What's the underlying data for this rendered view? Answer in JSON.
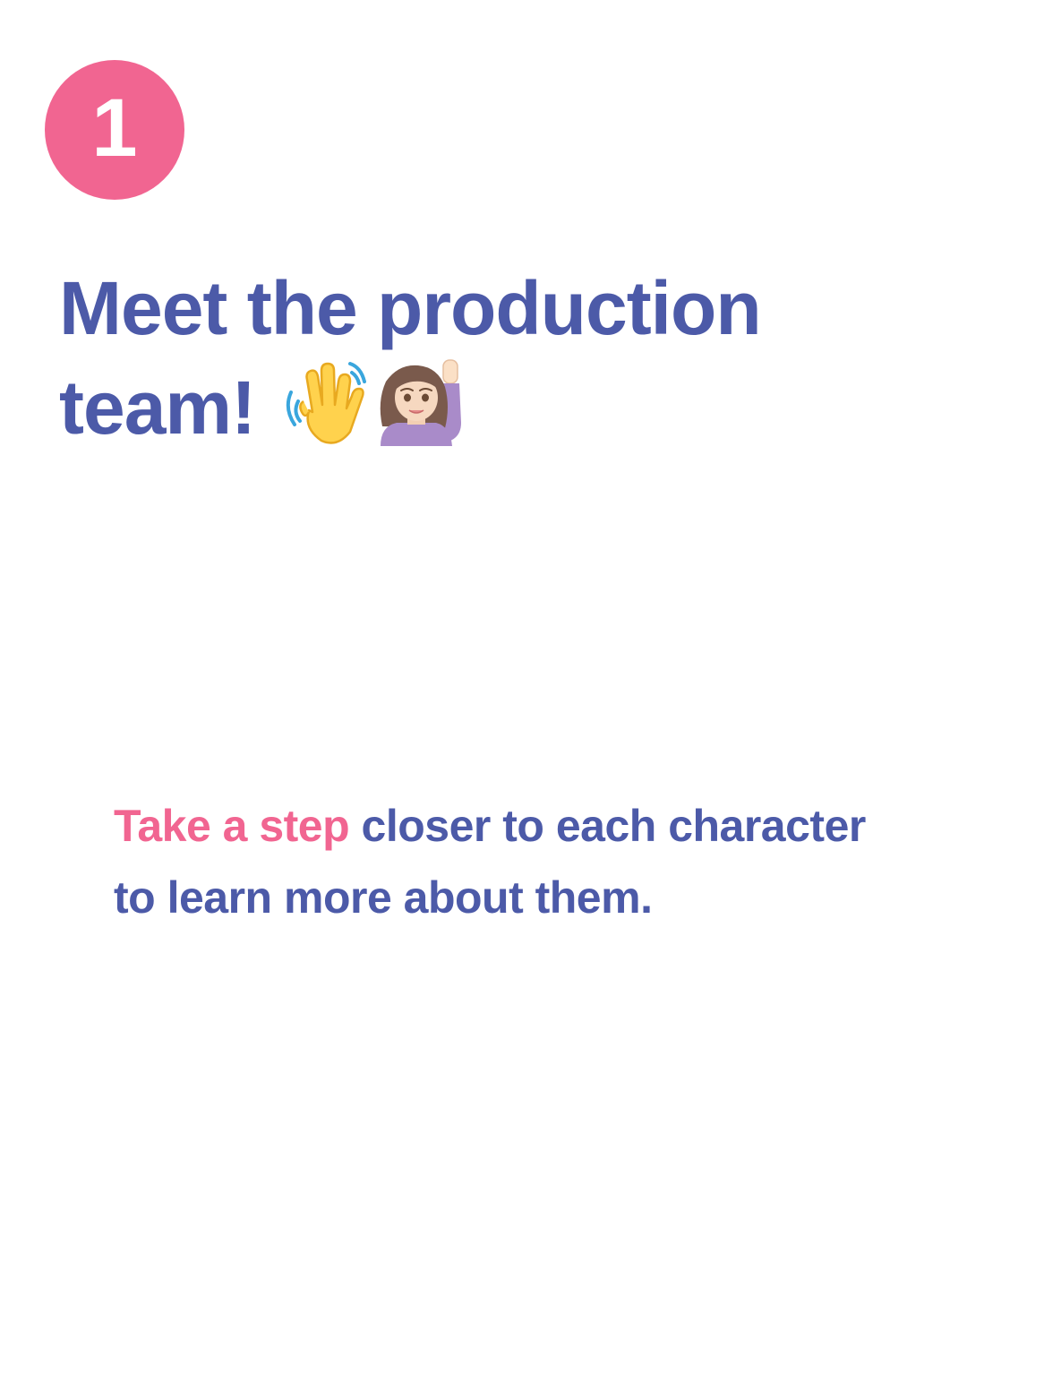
{
  "step": {
    "number": "1"
  },
  "title": {
    "line1": "Meet the production",
    "line2": "team!",
    "emojis": [
      "waving-hand-icon",
      "person-raising-hand-icon"
    ]
  },
  "body": {
    "highlight": "Take a step",
    "line1_rest": " closer to each character",
    "line2": "to learn more about them."
  },
  "colors": {
    "accent_pink": "#f16591",
    "primary_blue": "#4c5aa8",
    "background": "#ffffff"
  }
}
